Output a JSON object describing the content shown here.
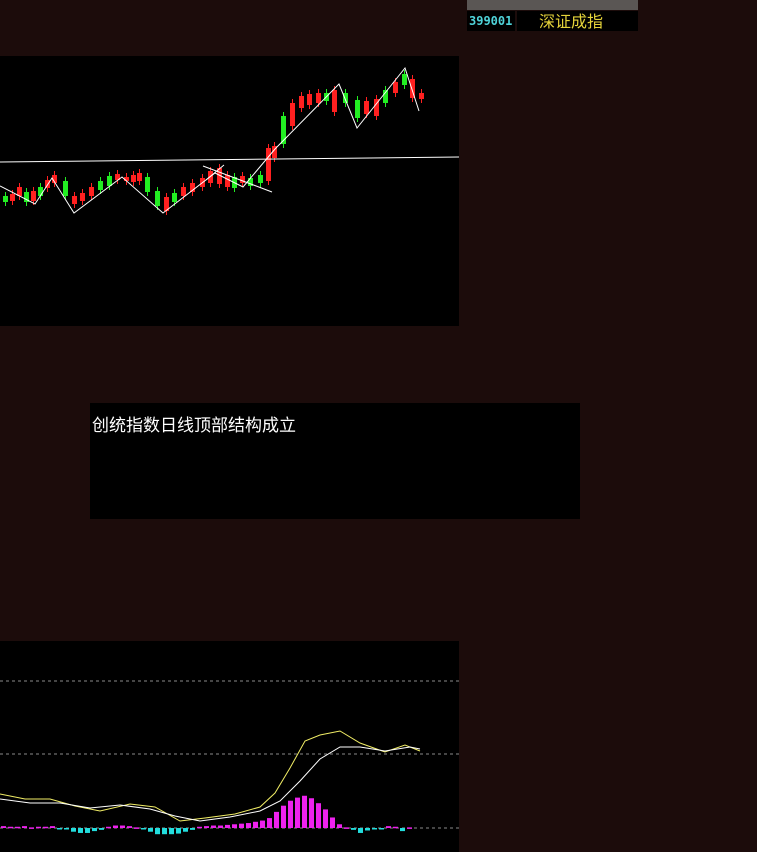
{
  "ticker": {
    "code": "399001",
    "name": "深证成指",
    "code_color": "#4fd3d9",
    "name_color": "#e6d43a"
  },
  "caption": {
    "text": "创统指数日线顶部结构成立"
  },
  "colors": {
    "background": "#1c0c0b",
    "panel": "#000000",
    "up_candle": "#ff2020",
    "down_candle": "#22ee22",
    "macd_positive": "#ee22ee",
    "macd_negative": "#22dddd",
    "dif_line": "#f2ee66",
    "dea_line": "#ffffff",
    "annotation_line": "#ffffff"
  },
  "chart_data": [
    {
      "type": "candlestick",
      "candles_up_down": [
        "down",
        "up",
        "up",
        "down",
        "up",
        "down",
        "up",
        "up",
        "down",
        "up",
        "up",
        "up",
        "down",
        "down",
        "up",
        "up",
        "up",
        "up",
        "down",
        "down",
        "up",
        "down",
        "up",
        "up",
        "up",
        "up",
        "up",
        "up",
        "down",
        "up",
        "down",
        "down",
        "up",
        "up",
        "down",
        "up",
        "up",
        "up",
        "up",
        "down",
        "up",
        "down"
      ],
      "annotations": [
        "horizontal support/resistance line",
        "zigzag trend line",
        "top structure lines"
      ]
    },
    {
      "type": "bar",
      "indicator": "MACD",
      "series": [
        {
          "values": [
            0.3,
            0.2,
            0.2,
            0.3,
            0.1,
            0.2,
            0.2,
            0.3,
            -0.1,
            -0.2,
            -0.6,
            -0.8,
            -0.8,
            -0.5,
            -0.3,
            0.2,
            0.4,
            0.4,
            0.3,
            0.1,
            -0.1,
            -0.6,
            -1.0,
            -1.0,
            -1.0,
            -0.9,
            -0.6,
            -0.3,
            0.2,
            0.3,
            0.4,
            0.4,
            0.5,
            0.6,
            0.7,
            0.8,
            1.0,
            1.2,
            1.6,
            2.6,
            3.6,
            4.4,
            4.9,
            5.2,
            4.8,
            4.0,
            3.0,
            1.7,
            0.6,
            0.1,
            -0.3,
            -0.8,
            -0.4,
            -0.2,
            -0.1,
            0.3,
            0.2,
            -0.5,
            0.1
          ]
        }
      ],
      "reference_levels": [
        "upper dashed",
        "middle dashed",
        "zero dashed"
      ]
    }
  ]
}
